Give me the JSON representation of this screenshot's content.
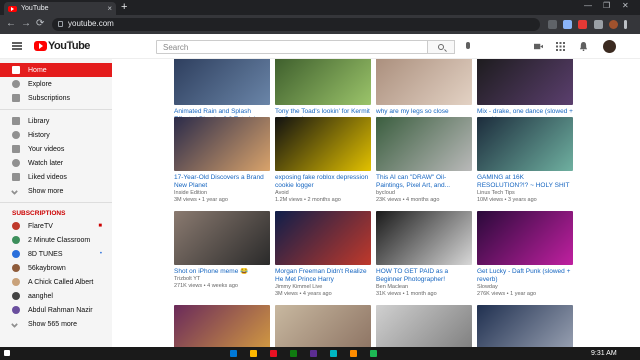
{
  "browser": {
    "tab_title": "YouTube",
    "url": "youtube.com",
    "close_glyph": "×",
    "new_tab_glyph": "+",
    "window_controls": [
      "—",
      "❐",
      "✕"
    ],
    "nav_back": "←",
    "nav_forward": "→",
    "nav_reload": "⟳"
  },
  "header": {
    "logo_text": "YouTube",
    "logo_superscript": "CA",
    "search_placeholder": "Search",
    "icons": [
      "menu-icon",
      "search-icon",
      "mic-icon",
      "create-video-icon",
      "apps-icon",
      "notifications-icon",
      "avatar"
    ]
  },
  "sidebar": {
    "main_items": [
      {
        "label": "Home",
        "icon": "home-icon",
        "active": true
      },
      {
        "label": "Explore",
        "icon": "explore-icon",
        "active": false
      },
      {
        "label": "Subscriptions",
        "icon": "subscriptions-icon",
        "active": false
      }
    ],
    "library_items": [
      {
        "label": "Library",
        "icon": "library-icon"
      },
      {
        "label": "History",
        "icon": "history-icon"
      },
      {
        "label": "Your videos",
        "icon": "your-videos-icon"
      },
      {
        "label": "Watch later",
        "icon": "watch-later-icon"
      },
      {
        "label": "Liked videos",
        "icon": "liked-videos-icon"
      },
      {
        "label": "Show more",
        "icon": "chevron-down-icon"
      }
    ],
    "subscriptions_heading": "SUBSCRIPTIONS",
    "subscriptions": [
      {
        "label": "FlareTV",
        "badge": "live",
        "color": "#c0392b"
      },
      {
        "label": "2 Minute Classroom",
        "badge": "",
        "color": "#3d8f5c"
      },
      {
        "label": "8D TUNES",
        "badge": "dot",
        "color": "#2a6fdb"
      },
      {
        "label": "56kaybrown",
        "badge": "",
        "color": "#8e5b3a"
      },
      {
        "label": "A Chick Called Albert",
        "badge": "",
        "color": "#c9a27a"
      },
      {
        "label": "aanghel",
        "badge": "",
        "color": "#444444"
      },
      {
        "label": "Abdul Rahman Nazir",
        "badge": "",
        "color": "#6a4f9e"
      },
      {
        "label": "Show 565 more",
        "badge": "",
        "color": ""
      }
    ]
  },
  "videos": [
    {
      "title": "Animated Rain and Splash Effects | Blender 2.8 Tutorial",
      "channel": "CG Geek",
      "stats": "681K views • 1 year ago",
      "palette": [
        "#2b3b5a",
        "#6a85a8"
      ]
    },
    {
      "title": "Tony the Toad's lookin' for Kermit on Omegle",
      "channel": "Maxamili",
      "stats": "162K views • 1 day ago",
      "palette": [
        "#3a5a2a",
        "#9bc46a"
      ]
    },
    {
      "title": "why are my legs so close together",
      "channel": "Dylan Beg Fitness",
      "stats": "No views • 58 seconds ago",
      "palette": [
        "#a88c7a",
        "#e3d2c4"
      ]
    },
    {
      "title": "Mix - drake, one dance (slowed + reverb)",
      "channel": "Drake, Wizkid, Kyla Reid, and more",
      "stats": "",
      "palette": [
        "#1a1a1a",
        "#5b3f6e"
      ]
    },
    {
      "title": "17-Year-Old Discovers a Brand New Planet",
      "channel": "Inside Edition",
      "stats": "3M views • 1 year ago",
      "palette": [
        "#2b2b4a",
        "#d9a36b"
      ]
    },
    {
      "title": "exposing fake roblox depression cookie logger",
      "channel": "Avoid",
      "stats": "1.2M views • 2 months ago",
      "palette": [
        "#111111",
        "#e2c100"
      ]
    },
    {
      "title": "This AI can \"DRAW\" Oil-Paintings, Pixel Art, and...",
      "channel": "bycloud",
      "stats": "23K views • 4 months ago",
      "palette": [
        "#3b5e3f",
        "#b9b9b9"
      ]
    },
    {
      "title": "GAMING at 16K RESOLUTION?!? ~ HOLY SHIT",
      "channel": "Linus Tech Tips",
      "stats": "10M views • 3 years ago",
      "palette": [
        "#1c2c3c",
        "#6fb0a0"
      ]
    },
    {
      "title": "Shot on iPhone meme 😂",
      "channel": "Trizbolt YT",
      "stats": "271K views • 4 weeks ago",
      "palette": [
        "#8a7a70",
        "#2a2a2a"
      ]
    },
    {
      "title": "Morgan Freeman Didn't Realize He Met Prince Harry",
      "channel": "Jimmy Kimmel Live",
      "stats": "3M views • 4 years ago",
      "palette": [
        "#0f1e4a",
        "#c0392b"
      ]
    },
    {
      "title": "HOW TO GET PAID as a Beginner Photographer!",
      "channel": "Ben Maclean",
      "stats": "31K views • 1 month ago",
      "palette": [
        "#1a1a1a",
        "#d8d8d8"
      ]
    },
    {
      "title": "Get Lucky - Daft Punk (slowed + reverb)",
      "channel": "Slowday",
      "stats": "276K views • 1 year ago",
      "palette": [
        "#2a0a3a",
        "#c020a0"
      ]
    },
    {
      "title": "",
      "channel": "",
      "stats": "",
      "palette": [
        "#6a2a5a",
        "#d8a040"
      ]
    },
    {
      "title": "",
      "channel": "",
      "stats": "",
      "palette": [
        "#c8b8a0",
        "#8a7060"
      ]
    },
    {
      "title": "",
      "channel": "",
      "stats": "",
      "palette": [
        "#d0d0d0",
        "#7a7a7a"
      ]
    },
    {
      "title": "",
      "channel": "",
      "stats": "",
      "palette": [
        "#203050",
        "#a0a8b8"
      ]
    }
  ],
  "taskbar": {
    "clock": "9:31 AM",
    "apps": [
      "#0078d7",
      "#ffb900",
      "#e81123",
      "#107c10",
      "#5c2d91",
      "#00b7c3",
      "#ff8c00",
      "#1db954"
    ]
  },
  "colors": {
    "brand_red": "#ff0000",
    "active_item": "#e41c1c",
    "link_blue": "#1565c0"
  }
}
